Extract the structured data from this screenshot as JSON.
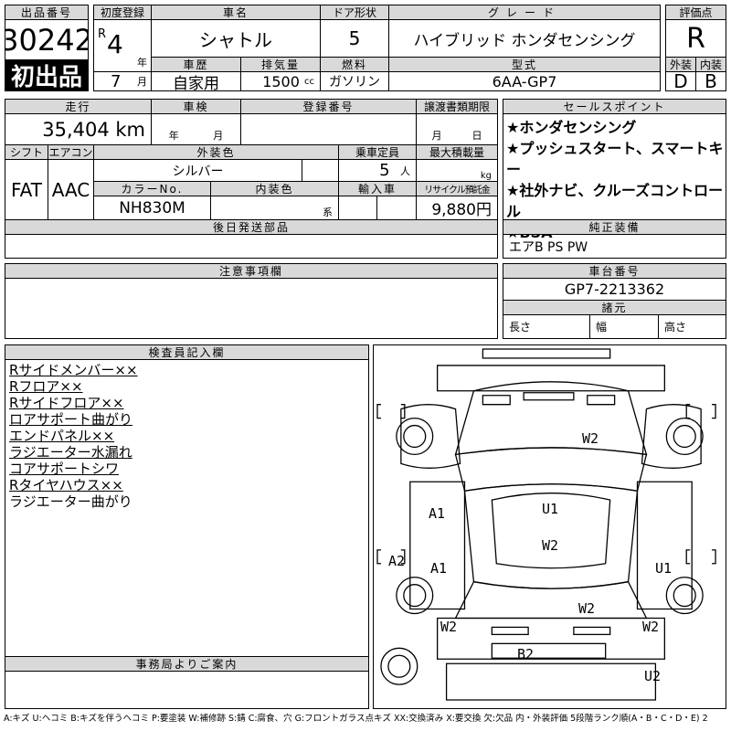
{
  "lot": {
    "label": "出品番号",
    "number": "30242",
    "badge": "初出品"
  },
  "first_reg": {
    "label": "初度登録",
    "era": "R",
    "year": "4",
    "year_unit": "年",
    "month": "7",
    "month_unit": "月"
  },
  "car_name": {
    "label": "車名",
    "value": "シャトル"
  },
  "door": {
    "label": "ドア形状",
    "value": "5"
  },
  "grade": {
    "label": "グレード",
    "value": "ハイブリッド ホンダセンシング"
  },
  "history": {
    "label": "車歴",
    "value": "自家用"
  },
  "displacement": {
    "label": "排気量",
    "value": "1500",
    "unit": "cc"
  },
  "fuel": {
    "label": "燃料",
    "value": "ガソリン"
  },
  "model": {
    "label": "型式",
    "value": "6AA-GP7"
  },
  "score": {
    "label": "評価点",
    "value": "R",
    "ext_label": "外装",
    "int_label": "内装",
    "ext": "D",
    "int": "B"
  },
  "mileage": {
    "label": "走行",
    "value": "35,404 km"
  },
  "inspection": {
    "label": "車検",
    "year_unit": "年",
    "month_unit": "月"
  },
  "reg_no": {
    "label": "登録番号"
  },
  "transfer": {
    "label": "譲渡書類期限",
    "month_unit": "月",
    "day_unit": "日"
  },
  "shift": {
    "label": "シフト",
    "value": "FAT"
  },
  "ac": {
    "label": "エアコン",
    "value": "AAC"
  },
  "ext_color": {
    "label": "外装色",
    "value": "シルバー"
  },
  "capacity": {
    "label": "乗車定員",
    "value": "5",
    "unit": "人"
  },
  "max_load": {
    "label": "最大積載量",
    "unit": "kg"
  },
  "color_no": {
    "label": "カラーNo.",
    "value": "NH830M"
  },
  "int_color": {
    "label": "内装色",
    "unit": "系"
  },
  "import": {
    "label": "輸入車"
  },
  "recycle": {
    "label": "リサイクル預託金",
    "value": "9,880円"
  },
  "later_parts": {
    "label": "後日発送部品"
  },
  "sales": {
    "label": "セールスポイント",
    "items": [
      "★ホンダセンシング",
      "★プッシュスタート、スマートキー",
      "★社外ナビ、クルーズコントロール",
      "★BSA"
    ]
  },
  "equipment": {
    "label": "純正装備",
    "value": "エアB PS PW"
  },
  "notes": {
    "label": "注意事項欄"
  },
  "chassis": {
    "label": "車台番号",
    "value": "GP7-2213362"
  },
  "specs": {
    "label": "諸元",
    "length": "長さ",
    "width": "幅",
    "height": "高さ"
  },
  "inspector": {
    "label": "検査員記入欄",
    "items": [
      "Rサイドメンバー××",
      "Rフロア××",
      "Rサイドフロア××",
      "ロアサポート曲がり",
      "エンドパネル××",
      "ラジエーター水漏れ",
      "コアサポートシワ",
      "Rタイヤハウス××",
      "ラジエーター曲がり"
    ]
  },
  "office": {
    "label": "事務局よりご案内"
  },
  "diagram": {
    "marks": [
      "W2",
      "A1",
      "U1",
      "A1",
      "W2",
      "A2",
      "U1",
      "W2",
      "W2",
      "W2",
      "B2",
      "U2"
    ]
  },
  "legend": "A:キズ U:ヘコミ B:キズを伴うヘコミ P:要塗装 W:補修跡 S:錆 C:腐食、穴 G:フロントガラス点キズ XX:交換済み X:要交換 欠:欠品 内・外装評価 5段階ランク順(A・B・C・D・E) 2"
}
